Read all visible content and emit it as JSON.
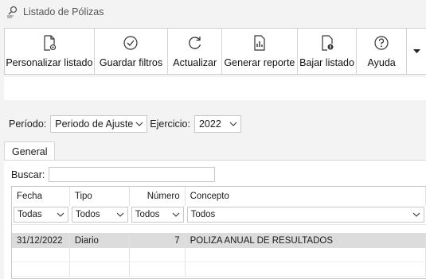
{
  "window": {
    "title": "Listado de Pólizas"
  },
  "toolbar": {
    "buttons": [
      {
        "label": "Personalizar listado",
        "icon": "customize-icon"
      },
      {
        "label": "Guardar filtros",
        "icon": "check-circle-icon"
      },
      {
        "label": "Actualizar",
        "icon": "refresh-icon"
      },
      {
        "label": "Generar reporte",
        "icon": "report-icon"
      },
      {
        "label": "Bajar listado",
        "icon": "download-doc-icon"
      },
      {
        "label": "Ayuda",
        "icon": "help-icon"
      }
    ]
  },
  "filters": {
    "periodo_label": "Período:",
    "periodo_value": "Periodo de Ajuste",
    "ejercicio_label": "Ejercicio:",
    "ejercicio_value": "2022"
  },
  "tabs": [
    "General"
  ],
  "search": {
    "label": "Buscar:",
    "value": ""
  },
  "grid": {
    "columns": [
      "Fecha",
      "Tipo",
      "Número",
      "Concepto"
    ],
    "filters": [
      "Todas",
      "Todos",
      "Todos",
      "Todos"
    ],
    "rows": [
      {
        "fecha": "31/12/2022",
        "tipo": "Diario",
        "numero": "7",
        "concepto": "POLIZA ANUAL DE RESULTADOS"
      }
    ]
  },
  "colors": {
    "accent": "#dcdcdc",
    "background": "#f3f3f3"
  }
}
